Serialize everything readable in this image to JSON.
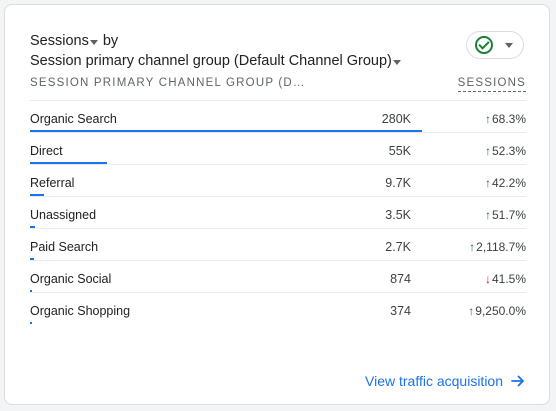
{
  "header": {
    "metric_label": "Sessions",
    "by_word": "by",
    "dimension_label": "Session primary channel group (Default Channel Group)"
  },
  "status_icon": "check-circle-icon",
  "table": {
    "col_dimension": "SESSION PRIMARY CHANNEL GROUP (D…",
    "col_metric": "SESSIONS",
    "rows": [
      {
        "label": "Organic Search",
        "value": "280K",
        "change": "68.3%",
        "direction": "up",
        "share": 1.0
      },
      {
        "label": "Direct",
        "value": "55K",
        "change": "52.3%",
        "direction": "up",
        "share": 0.196
      },
      {
        "label": "Referral",
        "value": "9.7K",
        "change": "42.2%",
        "direction": "up",
        "share": 0.035
      },
      {
        "label": "Unassigned",
        "value": "3.5K",
        "change": "51.7%",
        "direction": "up",
        "share": 0.0125
      },
      {
        "label": "Paid Search",
        "value": "2.7K",
        "change": "2,118.7%",
        "direction": "up",
        "share": 0.0096
      },
      {
        "label": "Organic Social",
        "value": "874",
        "change": "41.5%",
        "direction": "down",
        "share": 0.0031
      },
      {
        "label": "Organic Shopping",
        "value": "374",
        "change": "9,250.0%",
        "direction": "up",
        "share": 0.0013
      }
    ]
  },
  "footer": {
    "link_label": "View traffic acquisition"
  },
  "colors": {
    "accent": "#1a73e8",
    "positive": "#137333",
    "negative": "#c5221f"
  }
}
